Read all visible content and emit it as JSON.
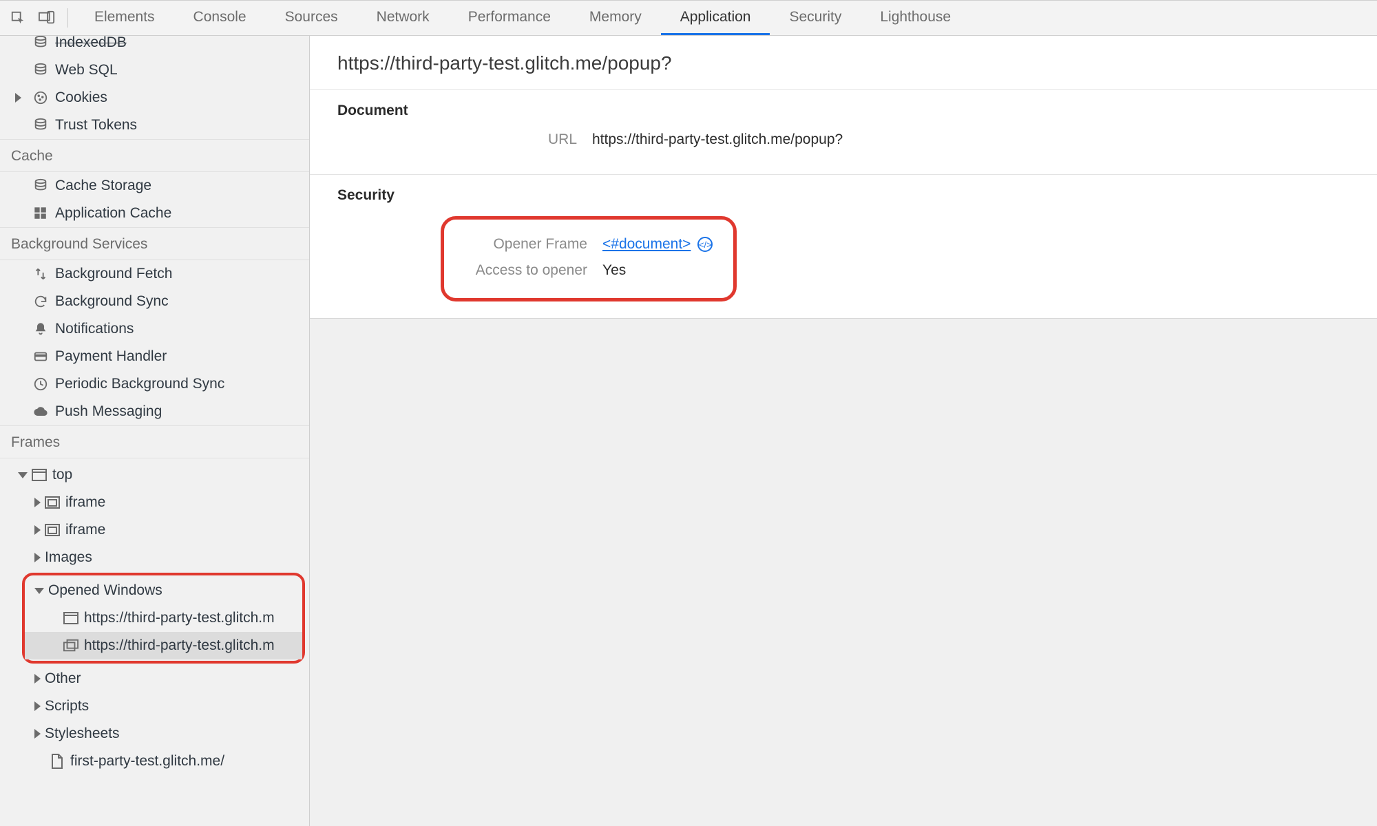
{
  "tabs": {
    "elements": "Elements",
    "console": "Console",
    "sources": "Sources",
    "network": "Network",
    "performance": "Performance",
    "memory": "Memory",
    "application": "Application",
    "security": "Security",
    "lighthouse": "Lighthouse"
  },
  "sidebar": {
    "storage": {
      "indexeddb": "IndexedDB",
      "websql": "Web SQL",
      "cookies": "Cookies",
      "trust_tokens": "Trust Tokens"
    },
    "cache_title": "Cache",
    "cache": {
      "cache_storage": "Cache Storage",
      "application_cache": "Application Cache"
    },
    "bgs_title": "Background Services",
    "bgs": {
      "background_fetch": "Background Fetch",
      "background_sync": "Background Sync",
      "notifications": "Notifications",
      "payment_handler": "Payment Handler",
      "periodic_background_sync": "Periodic Background Sync",
      "push_messaging": "Push Messaging"
    },
    "frames_title": "Frames",
    "frames": {
      "top": "top",
      "iframe1": "iframe",
      "iframe2": "iframe",
      "images": "Images",
      "opened_windows": "Opened Windows",
      "ow1": "https://third-party-test.glitch.m",
      "ow2": "https://third-party-test.glitch.m",
      "other": "Other",
      "scripts": "Scripts",
      "stylesheets": "Stylesheets",
      "leaf1": "first-party-test.glitch.me/"
    }
  },
  "detail": {
    "title": "https://third-party-test.glitch.me/popup?",
    "document_section": "Document",
    "url_label": "URL",
    "url_value": "https://third-party-test.glitch.me/popup?",
    "security_section": "Security",
    "opener_frame_label": "Opener Frame",
    "opener_frame_value": "<#document>",
    "access_label": "Access to opener",
    "access_value": "Yes"
  }
}
